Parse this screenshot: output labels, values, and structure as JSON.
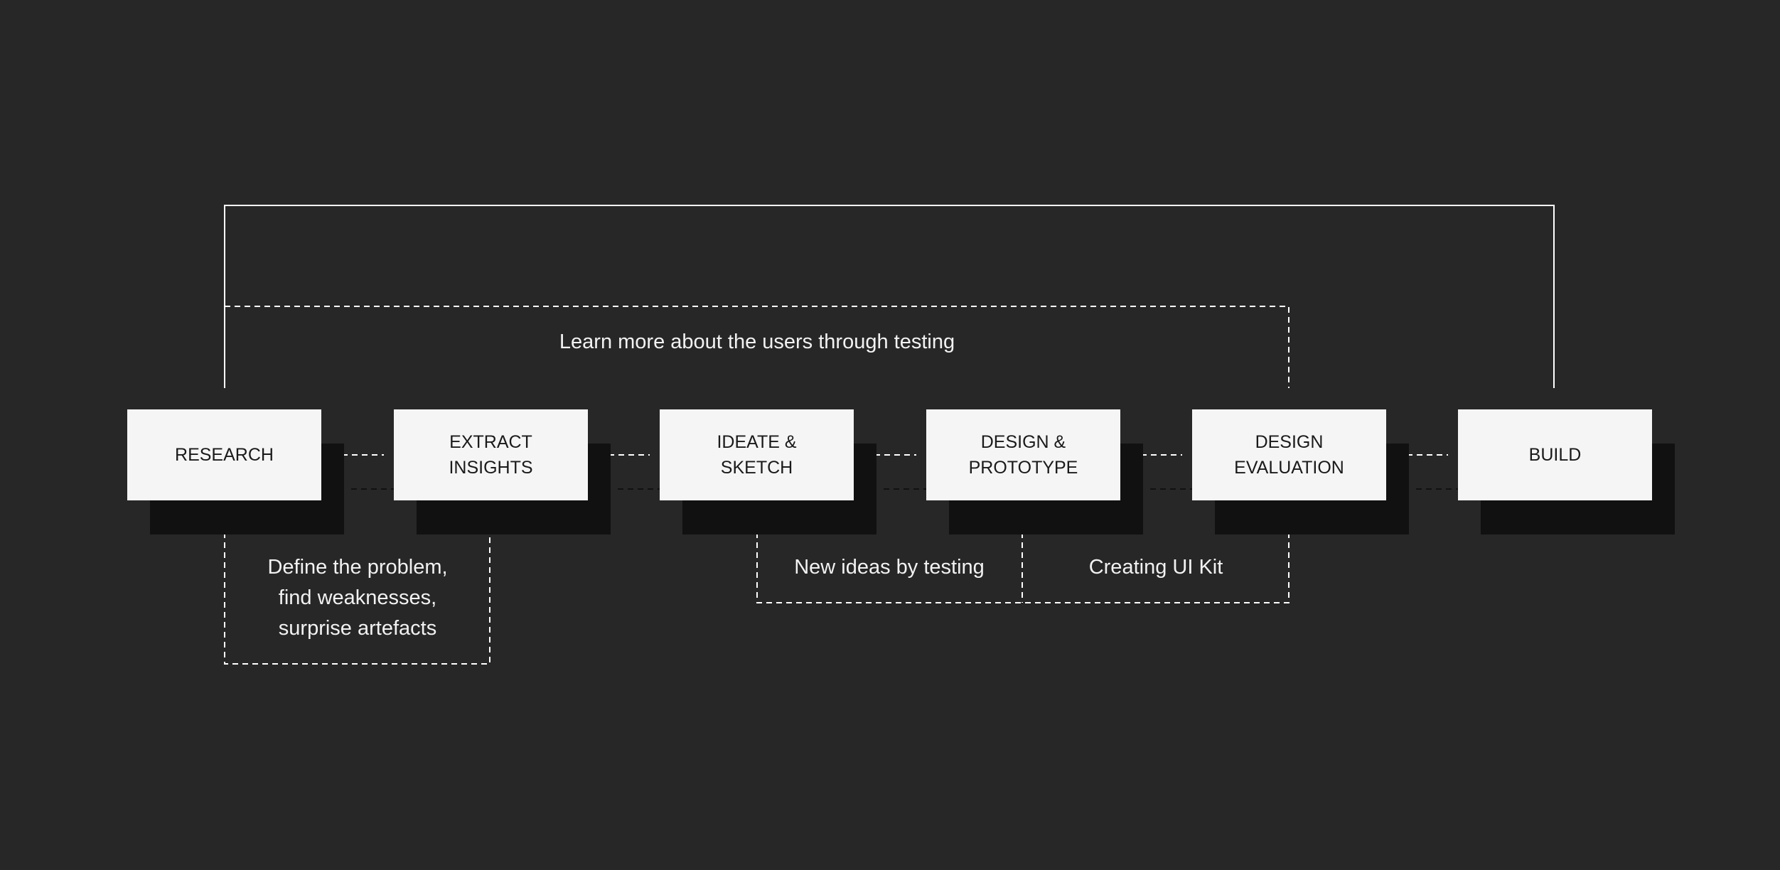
{
  "colors": {
    "background": "#272727",
    "box": "#f5f5f5",
    "shadow": "#111111",
    "line": "#ffffff"
  },
  "steps": [
    {
      "label": "RESEARCH"
    },
    {
      "label": "EXTRACT\nINSIGHTS"
    },
    {
      "label": "IDEATE &\nSKETCH"
    },
    {
      "label": "DESIGN &\nPROTOTYPE"
    },
    {
      "label": "DESIGN\nEVALUATION"
    },
    {
      "label": "BUILD"
    }
  ],
  "annotations": {
    "top_loop": "Learn more about the users through testing",
    "research_insights": "Define the problem,\nfind weaknesses,\nsurprise artefacts",
    "ideate_design": "New ideas by testing",
    "design_evaluation": "Creating UI Kit"
  }
}
